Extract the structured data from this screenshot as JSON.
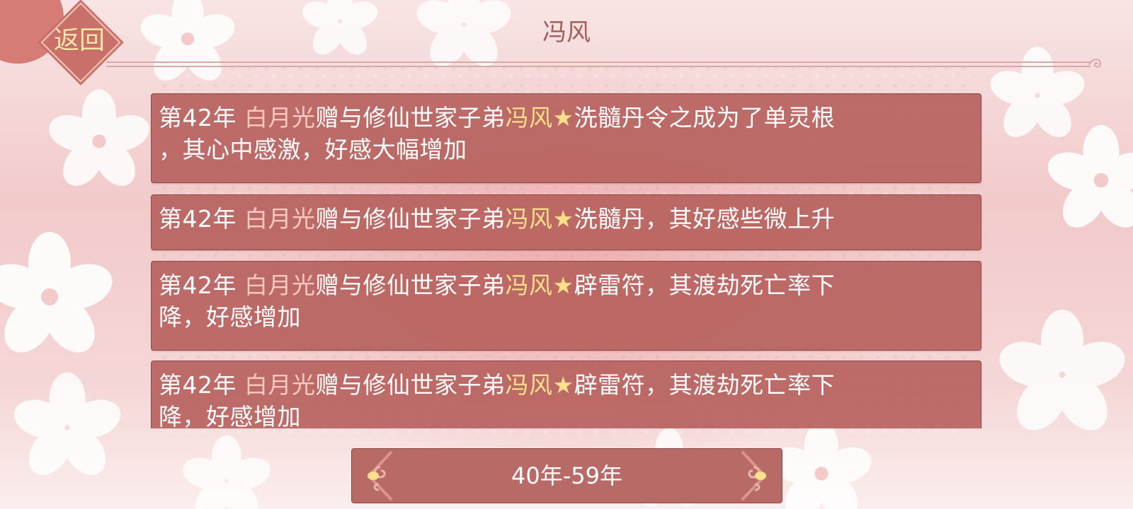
{
  "header": {
    "back_label": "返回",
    "title": "冯风"
  },
  "entries": [
    {
      "year": "第42年",
      "giver": "白月光",
      "verb": "赠与修仙世家子弟",
      "recipient": "冯风",
      "star": "★",
      "text_line1": "洗髓丹令之成为了单灵根",
      "text_line2": "，其心中感激，好感大幅增加"
    },
    {
      "year": "第42年",
      "giver": "白月光",
      "verb": "赠与修仙世家子弟",
      "recipient": "冯风",
      "star": "★",
      "text_line1": "洗髓丹，其好感些微上升",
      "text_line2": ""
    },
    {
      "year": "第42年",
      "giver": "白月光",
      "verb": "赠与修仙世家子弟",
      "recipient": "冯风",
      "star": "★",
      "text_line1": "辟雷符，其渡劫死亡率下",
      "text_line2": "降，好感增加"
    },
    {
      "year": "第42年",
      "giver": "白月光",
      "verb": "赠与修仙世家子弟",
      "recipient": "冯风",
      "star": "★",
      "text_line1": "辟雷符，其渡劫死亡率下",
      "text_line2": "降，好感增加"
    }
  ],
  "period_selector": {
    "label": "40年-59年"
  },
  "icons": {
    "back": "diamond-back-button",
    "prev": "cloud-arrow-left-icon",
    "next": "cloud-arrow-right-icon",
    "decoration": "cherry-blossom-icon"
  },
  "colors": {
    "entry_bg": "#b7625e",
    "giver_name": "#ffc8c0",
    "recipient_name": "#ffe08a",
    "title": "#a65c5a",
    "back_label": "#ffe7a6"
  }
}
